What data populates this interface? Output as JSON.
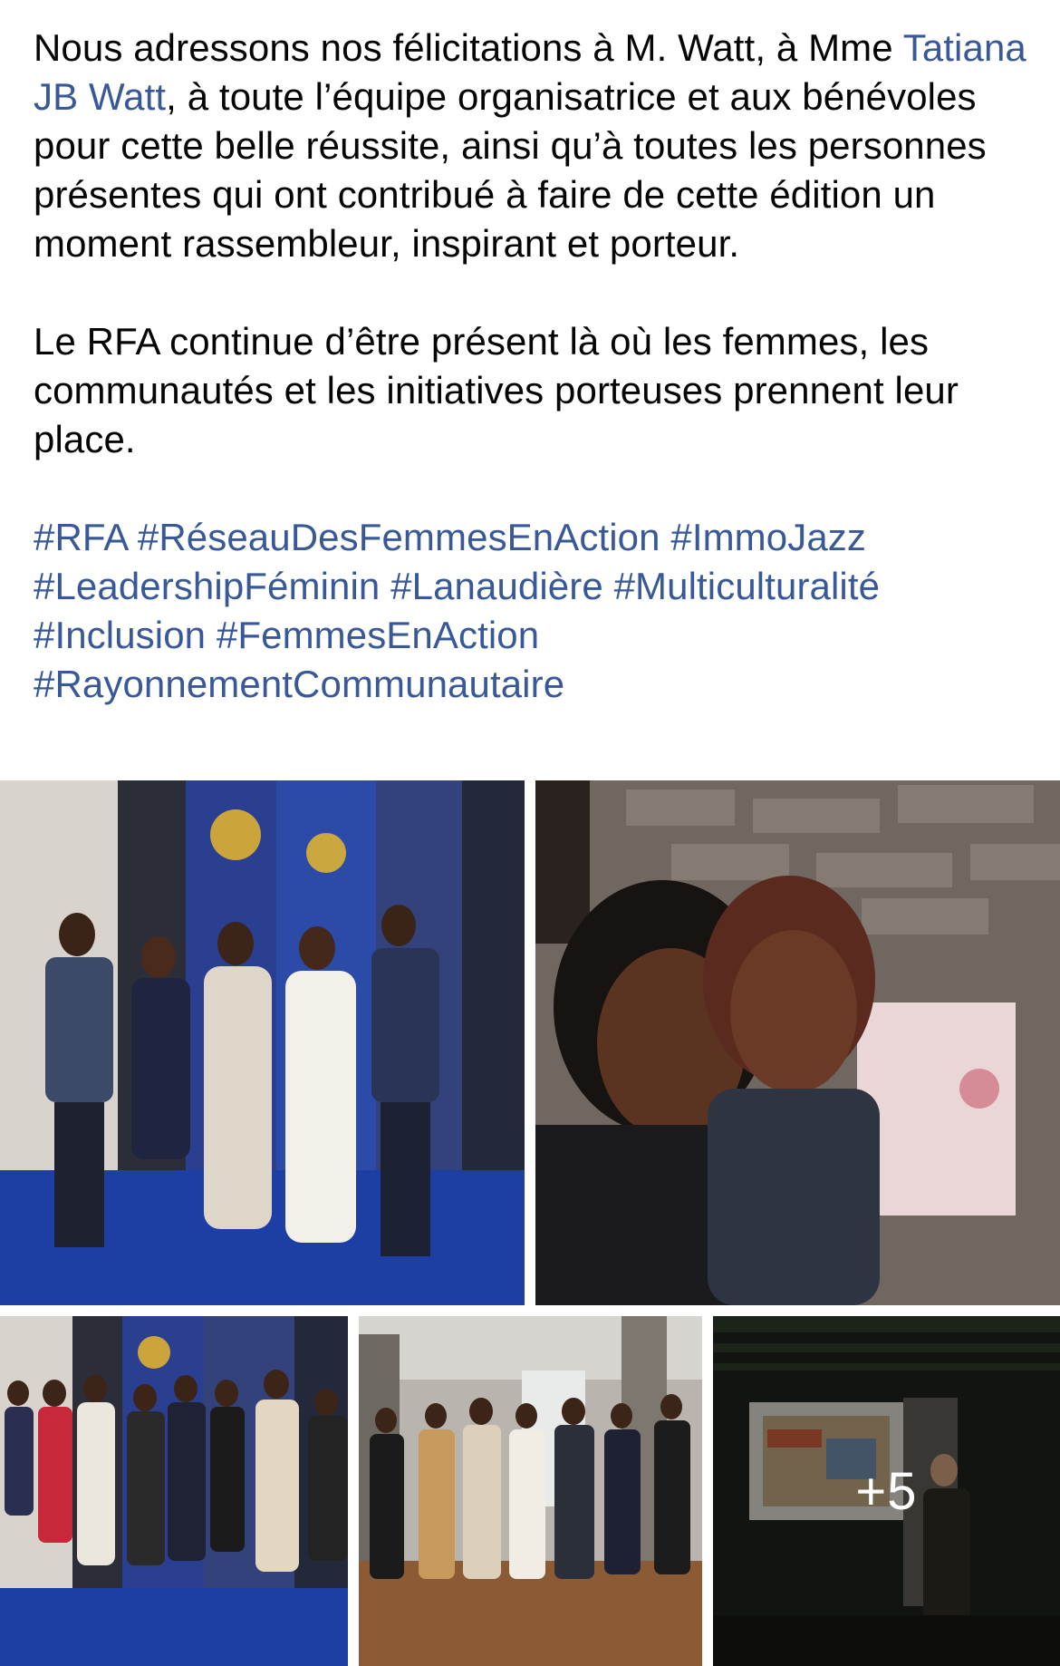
{
  "post": {
    "paragraph1": {
      "before_mention": "Nous adressons nos félicitations à M. Watt, à Mme ",
      "mention": "Tatiana JB Watt",
      "after_mention": ", à toute l’équipe organisatrice et aux bénévoles pour cette belle réussite, ainsi qu’à toutes les personnes présentes qui ont contribué à faire de cette édition un moment rassembleur, inspirant et porteur."
    },
    "paragraph2": "Le RFA continue d’être présent là où les femmes, les communautés et les initiatives porteuses prennent leur place.",
    "hashtags": [
      "#RFA",
      "#RéseauDesFemmesEnAction",
      "#ImmoJazz",
      "#LeadershipFéminin",
      "#Lanaudière",
      "#Multiculturalité",
      "#Inclusion",
      "#FemmesEnAction",
      "#RayonnementCommunautaire"
    ]
  },
  "gallery": {
    "more_count": "+5"
  },
  "colors": {
    "text": "#050505",
    "link": "#385898",
    "background": "#ffffff"
  }
}
